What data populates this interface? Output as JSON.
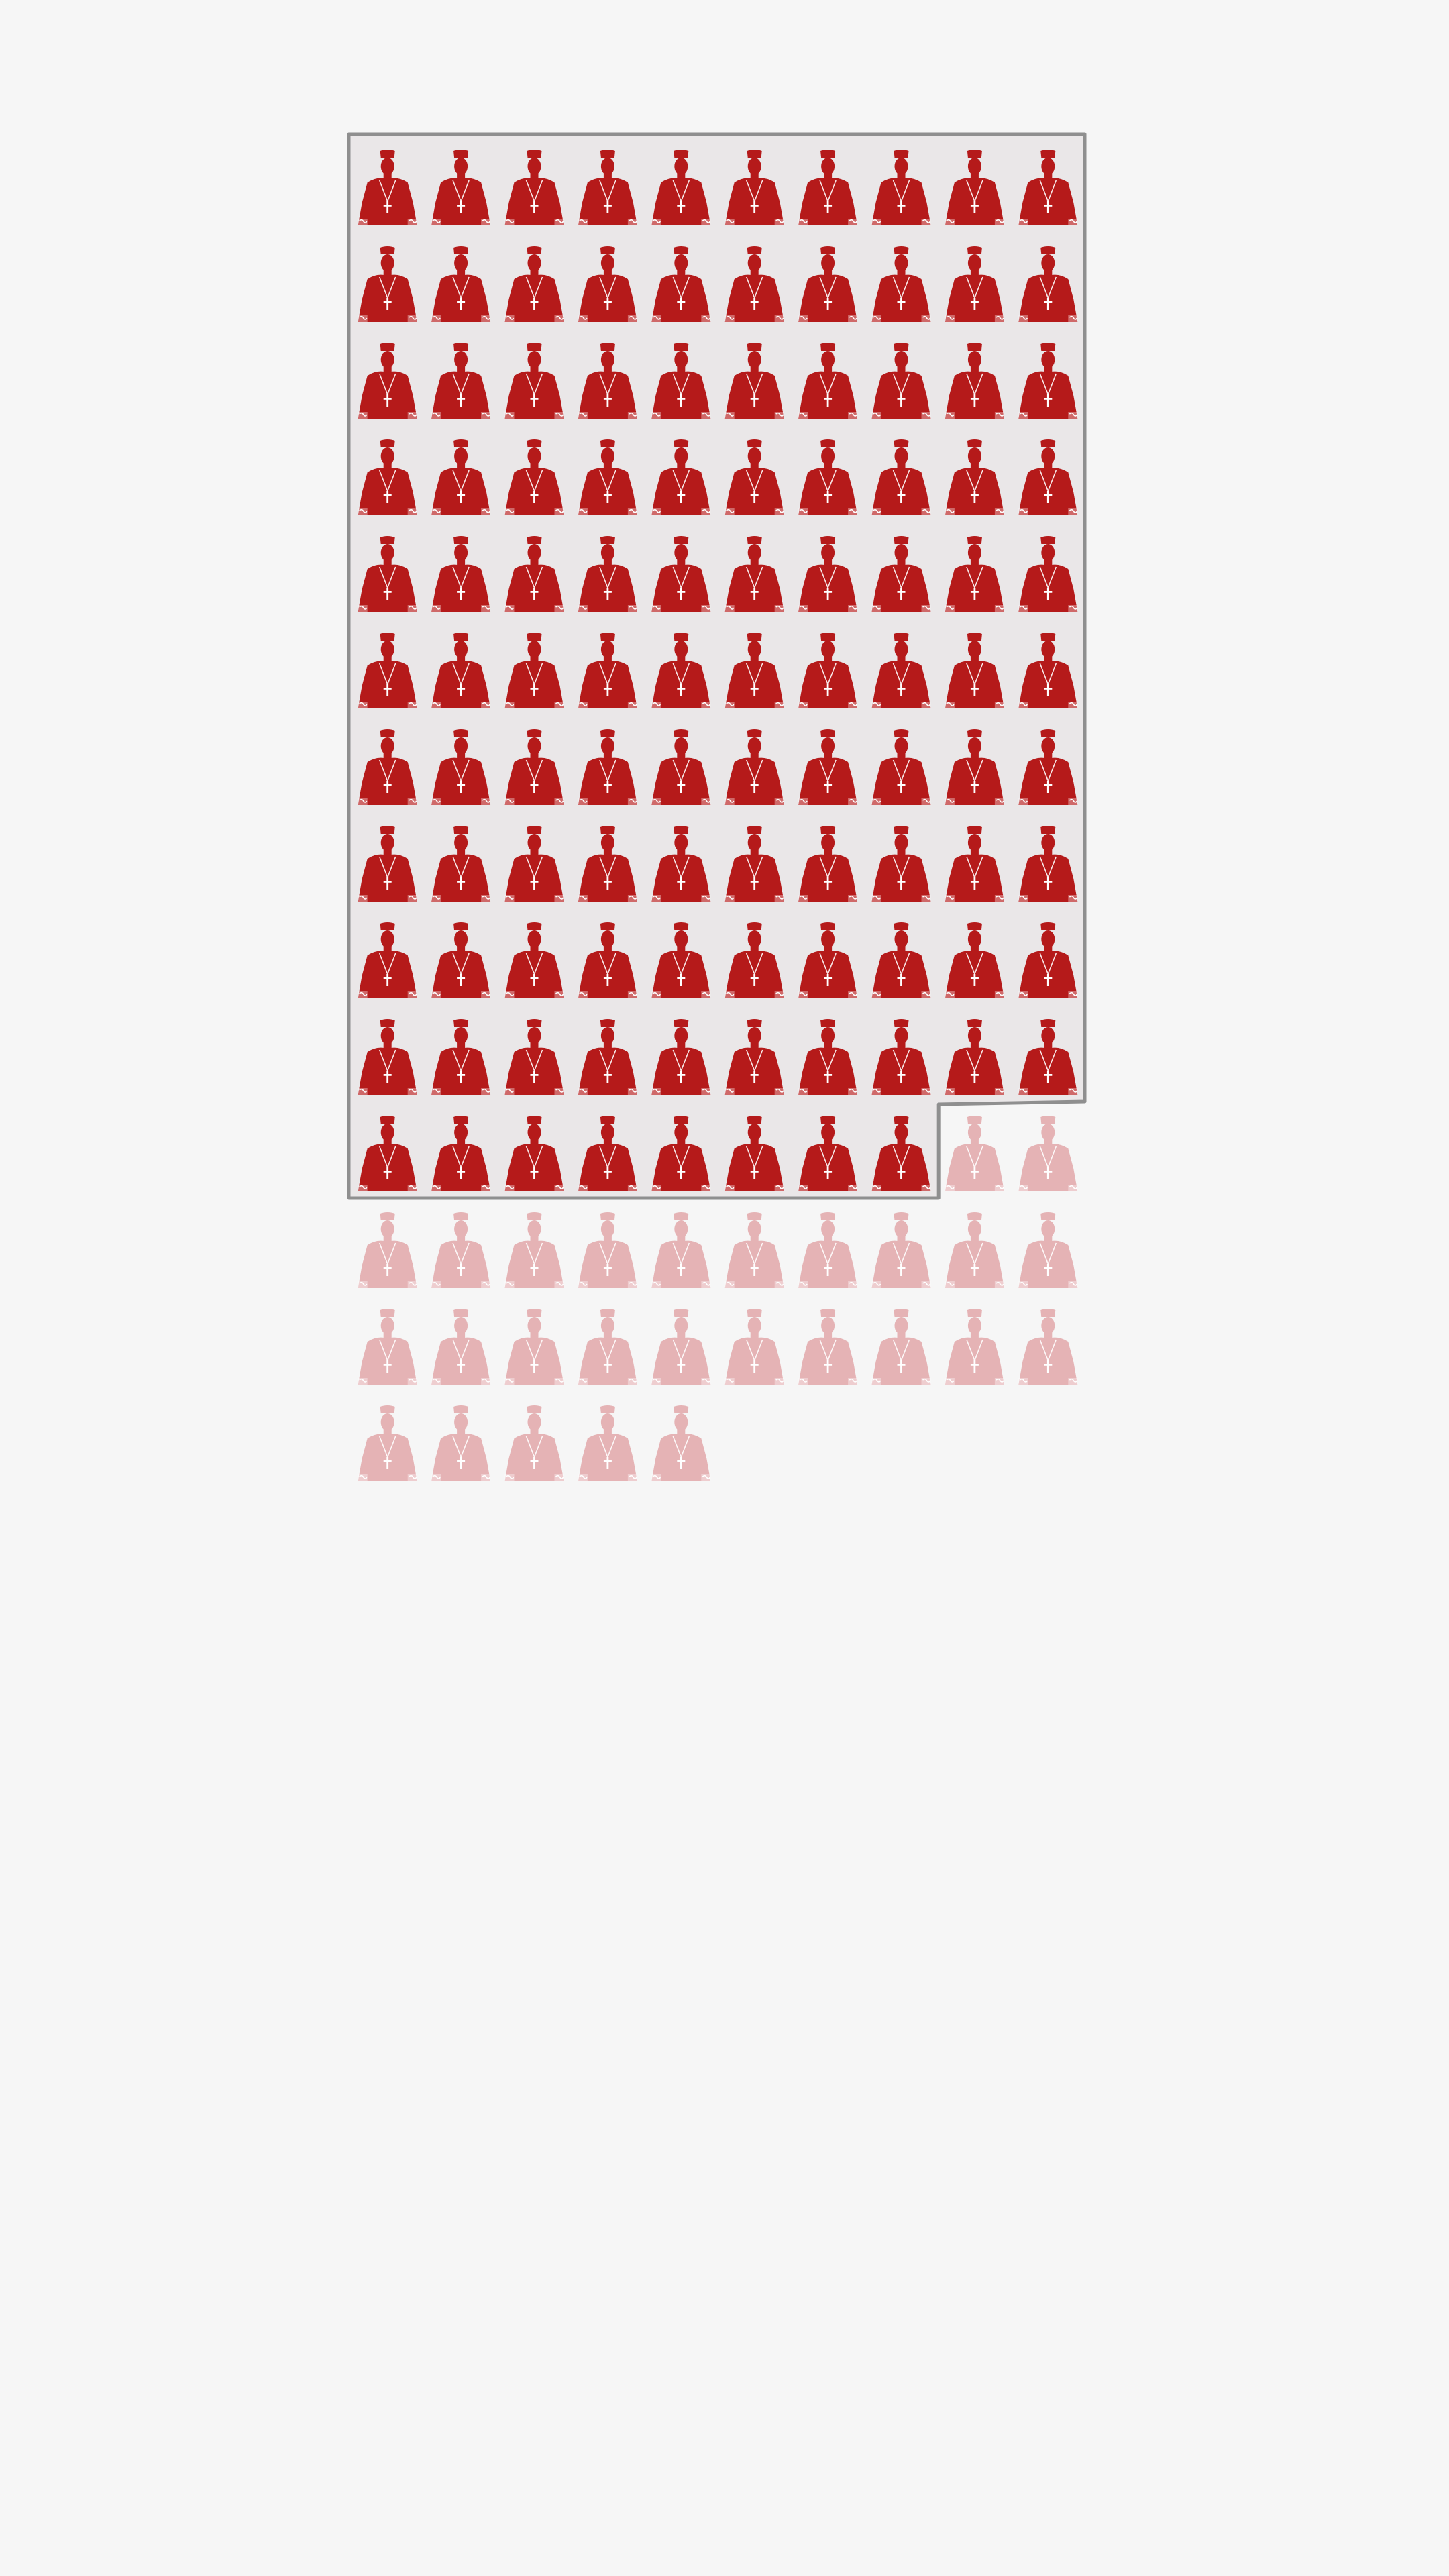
{
  "chart_data": {
    "type": "pictogram",
    "icon": "cardinal-bust-icon",
    "columns": 10,
    "total": 135,
    "highlighted": 108,
    "series": [
      {
        "count": 108,
        "color": "#b51a1a"
      },
      {
        "count": 27,
        "color": "#e5b3b5"
      }
    ],
    "highlight_region_fill": "#eae7e8",
    "highlight_region_stroke": "#8f8f8f"
  }
}
